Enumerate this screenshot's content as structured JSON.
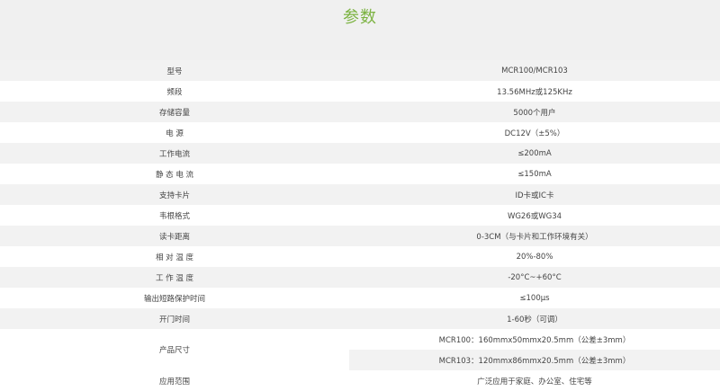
{
  "page": {
    "title": "参数"
  },
  "specs": [
    {
      "label": "型号",
      "value": "MCR100/MCR103"
    },
    {
      "label": "频段",
      "value": "13.56MHz或125KHz"
    },
    {
      "label": "存储容量",
      "value": "5000个用户"
    },
    {
      "label": "电  源",
      "value": "DC12V（±5%）"
    },
    {
      "label": "工作电流",
      "value": "≤200mA"
    },
    {
      "label": "静 态 电 流",
      "value": "≤150mA"
    },
    {
      "label": "支持卡片",
      "value": "ID卡或IC卡"
    },
    {
      "label": "韦根格式",
      "value": "WG26或WG34"
    },
    {
      "label": "读卡距离",
      "value": "0-3CM（与卡片和工作环境有关）"
    },
    {
      "label": "相 对 温 度",
      "value": "20%-80%"
    },
    {
      "label": "工 作 温 度",
      "value": "-20°C~+60°C"
    },
    {
      "label": "输出短路保护时间",
      "value": "≤100μs"
    },
    {
      "label": "开门时间",
      "value": "1-60秒（可调）"
    }
  ],
  "size_row": {
    "label": "产品尺寸",
    "values": [
      "MCR100：160mmx50mmx20.5mm（公差±3mm）",
      "MCR103：120mmx86mmx20.5mm（公差±3mm）"
    ]
  },
  "last_row": {
    "label": "应用范围",
    "value": "广泛应用于家庭、办公室、住宅等"
  }
}
